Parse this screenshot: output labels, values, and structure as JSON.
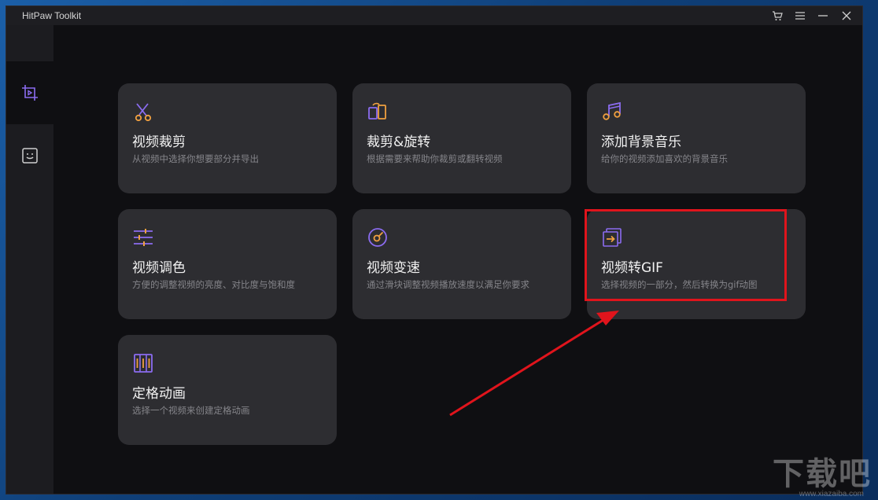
{
  "app": {
    "title": "HitPaw Toolkit"
  },
  "titlebar": {
    "cart_icon": "cart-icon",
    "menu_icon": "menu-icon",
    "minimize_icon": "minimize-icon",
    "close_icon": "close-icon"
  },
  "sidebar": {
    "items": [
      {
        "icon": "video-crop-icon",
        "active": true
      },
      {
        "icon": "face-icon",
        "active": false
      }
    ]
  },
  "cards": [
    {
      "title": "视频裁剪",
      "desc": "从视频中选择你想要部分并导出",
      "icon": "scissors-icon"
    },
    {
      "title": "裁剪&旋转",
      "desc": "根据需要来帮助你裁剪或翻转视频",
      "icon": "crop-rotate-icon"
    },
    {
      "title": "添加背景音乐",
      "desc": "给你的视频添加喜欢的背景音乐",
      "icon": "music-icon"
    },
    {
      "title": "视频调色",
      "desc": "方便的调整视频的亮度、对比度与饱和度",
      "icon": "sliders-icon"
    },
    {
      "title": "视频变速",
      "desc": "通过滑块调整视频播放速度以满足你要求",
      "icon": "speed-icon"
    },
    {
      "title": "视频转GIF",
      "desc": "选择视频的一部分，然后转换为gif动图",
      "icon": "gif-convert-icon"
    },
    {
      "title": "定格动画",
      "desc": "选择一个视频来创建定格动画",
      "icon": "stop-motion-icon"
    }
  ],
  "watermark": {
    "text": "下载吧",
    "sub": "www.xiazaiba.com"
  },
  "colors": {
    "accent_purple": "#8b6cf0",
    "accent_orange": "#f0a040",
    "card_bg": "#2d2d31",
    "annotation_red": "#e0141c"
  }
}
